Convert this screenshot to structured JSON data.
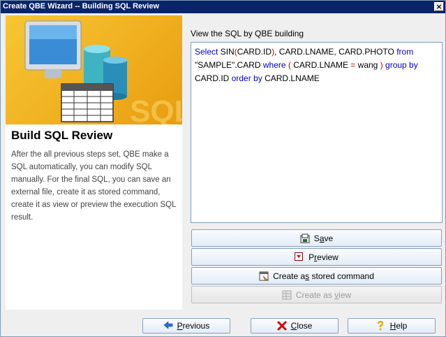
{
  "window": {
    "title": "Create QBE Wizard -- Building SQL Review",
    "close_glyph": "×"
  },
  "left": {
    "heading": "Build SQL Review",
    "description": "After the all previous steps set, QBE make a SQL automatically, you can modify SQL manually. For the final SQL, you can save an external file, create it as stored command, create it as view or preview the execution SQL result.",
    "banner_text": "SQL"
  },
  "sql": {
    "label": "View the SQL by QBE building",
    "kw_select": "Select",
    "fn_sin": "SIN",
    "p_open1": "(",
    "t_card_id1": "CARD.ID",
    "p_close1": ")",
    "t_rest1": ", CARD.LNAME, CARD.PHOTO",
    "kw_from": "from",
    "t_table": "\"SAMPLE\".CARD",
    "kw_where": "where",
    "p_open2": "(",
    "t_card_lname1": "CARD.LNAME",
    "op_eq": "=",
    "t_wang": "wang",
    "p_close2": ")",
    "kw_group": "group by",
    "t_card_id2": "CARD.ID",
    "kw_order": "order by",
    "t_card_lname2": "CARD.LNAME"
  },
  "actions": {
    "save_pre": "S",
    "save_ul": "a",
    "save_post": "ve",
    "preview_pre": "P",
    "preview_ul": "r",
    "preview_post": "eview",
    "stored_pre": "Create a",
    "stored_ul": "s",
    "stored_post": " stored command",
    "view_pre": "Create as ",
    "view_ul": "v",
    "view_post": "iew"
  },
  "footer": {
    "previous_ul": "P",
    "previous_post": "revious",
    "close_ul": "C",
    "close_post": "lose",
    "help_ul": "H",
    "help_post": "elp"
  },
  "colors": {
    "keyword": "#0000cc",
    "operator": "#cc0000",
    "titlebar": "#0a246a",
    "banner": "#f0b020"
  }
}
